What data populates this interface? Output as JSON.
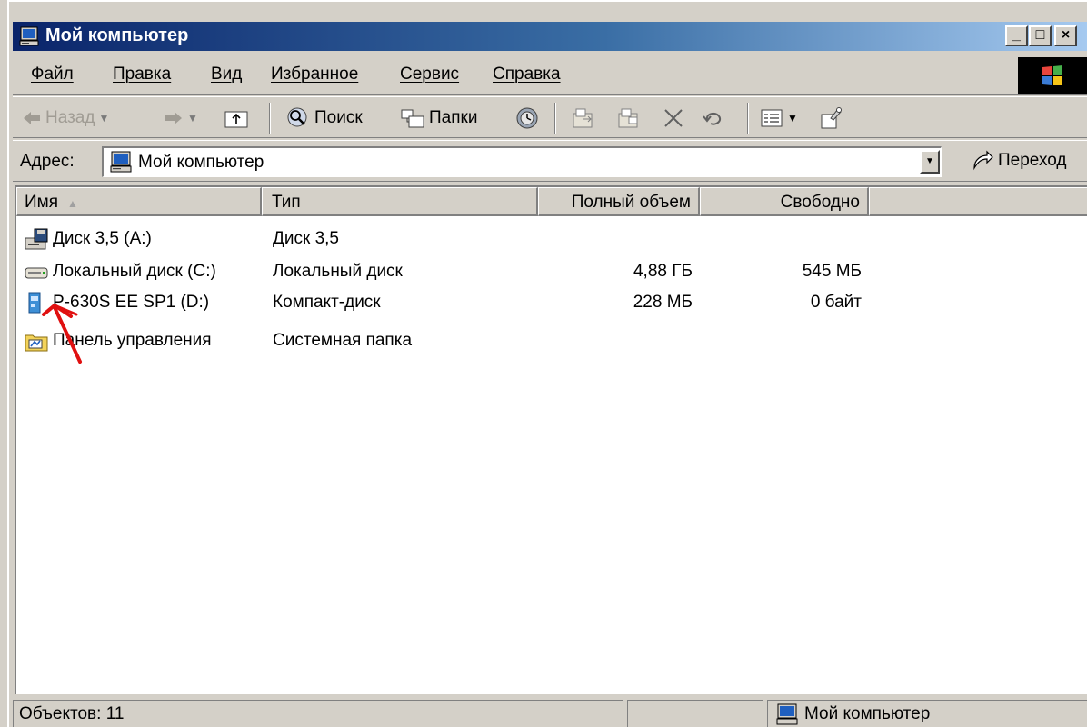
{
  "window": {
    "title": "Мой компьютер",
    "title_icon": "my-computer-icon",
    "caption_buttons": {
      "minimize": "_",
      "maximize": "□",
      "close": "×"
    }
  },
  "menu": {
    "file": "Файл",
    "edit": "Правка",
    "view": "Вид",
    "favorites": "Избранное",
    "tools": "Сервис",
    "help": "Справка"
  },
  "toolbar": {
    "back": "Назад",
    "search": "Поиск",
    "folders": "Папки"
  },
  "address": {
    "label": "Адрес:",
    "value": "Мой компьютер",
    "go": "Переход"
  },
  "columns": {
    "name": "Имя",
    "type": "Тип",
    "total": "Полный объем",
    "free": "Свободно"
  },
  "items": [
    {
      "name": "Диск 3,5 (A:)",
      "type": "Диск 3,5",
      "total": "",
      "free": "",
      "icon": "floppy-drive-icon"
    },
    {
      "name": "Локальный диск (C:)",
      "type": "Локальный диск",
      "total": "4,88 ГБ",
      "free": "545 МБ",
      "icon": "hard-drive-icon"
    },
    {
      "name": "P-630S EE SP1 (D:)",
      "type": "Компакт-диск",
      "total": "228 МБ",
      "free": "0 байт",
      "icon": "cd-drive-icon"
    },
    {
      "name": "Панель управления",
      "type": "Системная папка",
      "total": "",
      "free": "",
      "icon": "control-panel-icon"
    }
  ],
  "status": {
    "count": "Объектов: 11",
    "zone": "Мой компьютер"
  },
  "colors": {
    "titlebar_start": "#0a246a",
    "titlebar_end": "#a6caf0",
    "face": "#d4d0c8",
    "annotation_arrow": "#e01010"
  }
}
